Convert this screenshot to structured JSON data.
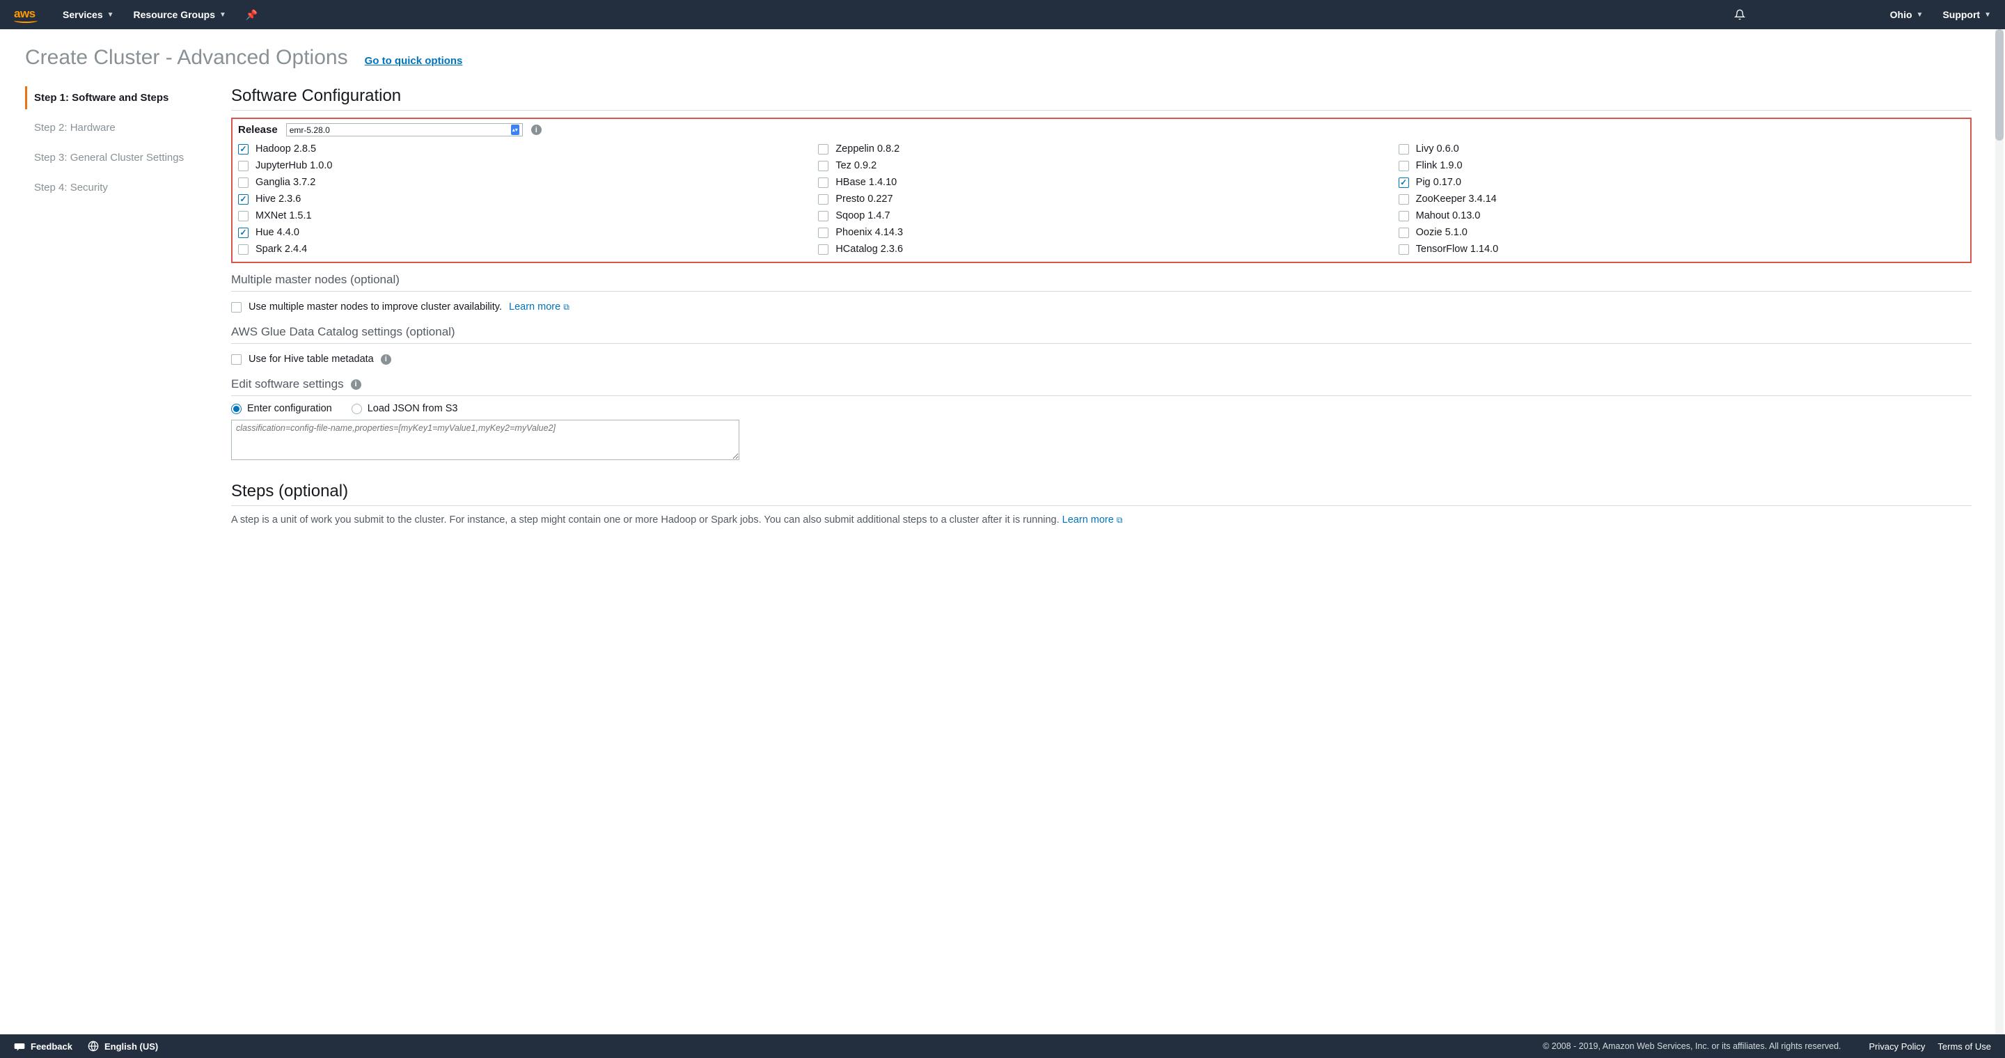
{
  "topnav": {
    "logo": "aws",
    "services": "Services",
    "resource_groups": "Resource Groups",
    "region": "Ohio",
    "support": "Support"
  },
  "page": {
    "title": "Create Cluster - Advanced Options",
    "quick_link": "Go to quick options"
  },
  "sidebar": {
    "steps": [
      {
        "label": "Step 1: Software and Steps",
        "active": true
      },
      {
        "label": "Step 2: Hardware",
        "active": false
      },
      {
        "label": "Step 3: General Cluster Settings",
        "active": false
      },
      {
        "label": "Step 4: Security",
        "active": false
      }
    ]
  },
  "software": {
    "heading": "Software Configuration",
    "release_label": "Release",
    "release_value": "emr-5.28.0",
    "apps": [
      {
        "label": "Hadoop 2.8.5",
        "checked": true
      },
      {
        "label": "Zeppelin 0.8.2",
        "checked": false
      },
      {
        "label": "Livy 0.6.0",
        "checked": false
      },
      {
        "label": "JupyterHub 1.0.0",
        "checked": false
      },
      {
        "label": "Tez 0.9.2",
        "checked": false
      },
      {
        "label": "Flink 1.9.0",
        "checked": false
      },
      {
        "label": "Ganglia 3.7.2",
        "checked": false
      },
      {
        "label": "HBase 1.4.10",
        "checked": false
      },
      {
        "label": "Pig 0.17.0",
        "checked": true
      },
      {
        "label": "Hive 2.3.6",
        "checked": true
      },
      {
        "label": "Presto 0.227",
        "checked": false
      },
      {
        "label": "ZooKeeper 3.4.14",
        "checked": false
      },
      {
        "label": "MXNet 1.5.1",
        "checked": false
      },
      {
        "label": "Sqoop 1.4.7",
        "checked": false
      },
      {
        "label": "Mahout 0.13.0",
        "checked": false
      },
      {
        "label": "Hue 4.4.0",
        "checked": true
      },
      {
        "label": "Phoenix 4.14.3",
        "checked": false
      },
      {
        "label": "Oozie 5.1.0",
        "checked": false
      },
      {
        "label": "Spark 2.4.4",
        "checked": false
      },
      {
        "label": "HCatalog 2.3.6",
        "checked": false
      },
      {
        "label": "TensorFlow 1.14.0",
        "checked": false
      }
    ]
  },
  "multi_master": {
    "heading": "Multiple master nodes (optional)",
    "label": "Use multiple master nodes to improve cluster availability.",
    "learn_more": "Learn more"
  },
  "glue": {
    "heading": "AWS Glue Data Catalog settings (optional)",
    "label": "Use for Hive table metadata"
  },
  "edit_settings": {
    "heading": "Edit software settings",
    "enter_config": "Enter configuration",
    "load_json": "Load JSON from S3",
    "placeholder": "classification=config-file-name,properties=[myKey1=myValue1,myKey2=myValue2]"
  },
  "steps_section": {
    "heading": "Steps (optional)",
    "desc_pre": "A step is a unit of work you submit to the cluster. For instance, a step might contain one or more Hadoop or Spark jobs. You can also submit additional steps to a cluster after it is running. ",
    "learn_more": "Learn more"
  },
  "footer": {
    "feedback": "Feedback",
    "language": "English (US)",
    "copyright": "© 2008 - 2019, Amazon Web Services, Inc. or its affiliates. All rights reserved.",
    "privacy": "Privacy Policy",
    "terms": "Terms of Use"
  }
}
